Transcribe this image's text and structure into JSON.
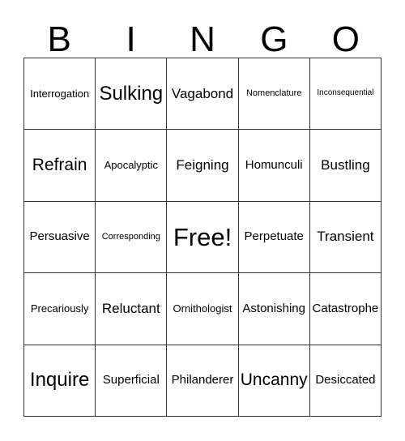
{
  "card": {
    "header": {
      "letters": [
        "B",
        "I",
        "N",
        "G",
        "O"
      ]
    },
    "free_space": "Free!",
    "rows": [
      [
        {
          "label": "Interrogation",
          "size": "fs-md"
        },
        {
          "label": "Sulking",
          "size": "fs-xxxl"
        },
        {
          "label": "Vagabond",
          "size": "fs-xl"
        },
        {
          "label": "Nomenclature",
          "size": "fs-sm"
        },
        {
          "label": "Inconsequential",
          "size": "fs-xs"
        }
      ],
      [
        {
          "label": "Refrain",
          "size": "fs-xxl"
        },
        {
          "label": "Apocalyptic",
          "size": "fs-md"
        },
        {
          "label": "Feigning",
          "size": "fs-xl"
        },
        {
          "label": "Homunculi",
          "size": "fs-lg"
        },
        {
          "label": "Bustling",
          "size": "fs-xl"
        }
      ],
      [
        {
          "label": "Persuasive",
          "size": "fs-lg"
        },
        {
          "label": "Corresponding",
          "size": "fs-sm"
        },
        {
          "label": "Free!",
          "size": "fs-free"
        },
        {
          "label": "Perpetuate",
          "size": "fs-lg"
        },
        {
          "label": "Transient",
          "size": "fs-xl"
        }
      ],
      [
        {
          "label": "Precariously",
          "size": "fs-md"
        },
        {
          "label": "Reluctant",
          "size": "fs-xl"
        },
        {
          "label": "Ornithologist",
          "size": "fs-md"
        },
        {
          "label": "Astonishing",
          "size": "fs-lg"
        },
        {
          "label": "Catastrophe",
          "size": "fs-lg"
        }
      ],
      [
        {
          "label": "Inquire",
          "size": "fs-xxxl"
        },
        {
          "label": "Superficial",
          "size": "fs-lg"
        },
        {
          "label": "Philanderer",
          "size": "fs-lg"
        },
        {
          "label": "Uncanny",
          "size": "fs-xxl"
        },
        {
          "label": "Desiccated",
          "size": "fs-lg"
        }
      ]
    ]
  },
  "colors": {
    "background": "#ffffff",
    "text": "#000000",
    "grid_line": "#333333"
  }
}
